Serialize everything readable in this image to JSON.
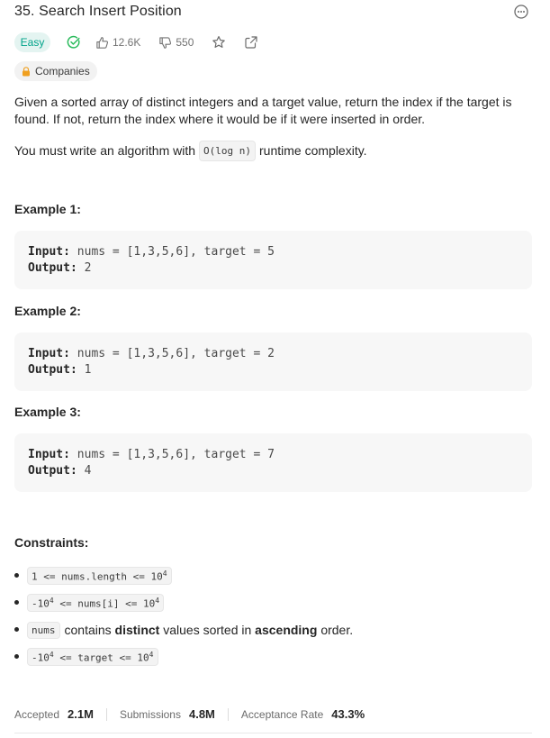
{
  "problem": {
    "title": "35. Search Insert Position",
    "difficulty": "Easy",
    "likes": "12.6K",
    "dislikes": "550",
    "companies_label": "Companies"
  },
  "description": {
    "paragraph1": "Given a sorted array of distinct integers and a target value, return the index if the target is found. If not, return the index where it would be if it were inserted in order.",
    "paragraph2_before": "You must write an algorithm with",
    "paragraph2_code": "O(log n)",
    "paragraph2_after": "runtime complexity."
  },
  "examples": [
    {
      "title": "Example 1:",
      "input_label": "Input:",
      "input": "nums = [1,3,5,6], target = 5",
      "output_label": "Output:",
      "output": "2"
    },
    {
      "title": "Example 2:",
      "input_label": "Input:",
      "input": "nums = [1,3,5,6], target = 2",
      "output_label": "Output:",
      "output": "1"
    },
    {
      "title": "Example 3:",
      "input_label": "Input:",
      "input": "nums = [1,3,5,6], target = 7",
      "output_label": "Output:",
      "output": "4"
    }
  ],
  "constraints": {
    "title": "Constraints:",
    "c1": {
      "left": "1 <= nums.length <= 10",
      "exp": "4"
    },
    "c2": {
      "pre": "-10",
      "pre_exp": "4",
      "mid": " <= nums[i] <= 10",
      "exp": "4"
    },
    "c3": {
      "code": "nums",
      "t1": "contains",
      "b1": "distinct",
      "t2": "values sorted in",
      "b2": "ascending",
      "t3": "order."
    },
    "c4": {
      "pre": "-10",
      "pre_exp": "4",
      "mid": " <= target <= 10",
      "exp": "4"
    }
  },
  "stats": {
    "accepted_label": "Accepted",
    "accepted_value": "2.1M",
    "submissions_label": "Submissions",
    "submissions_value": "4.8M",
    "rate_label": "Acceptance Rate",
    "rate_value": "43.3%"
  },
  "colors": {
    "easy": "#00a38a",
    "easy_bg": "#e4f4f1",
    "lock": "#f0a020"
  },
  "icons": [
    "more-icon",
    "solved-check-icon",
    "thumbs-up-icon",
    "thumbs-down-icon",
    "star-icon",
    "share-icon",
    "lock-icon"
  ]
}
